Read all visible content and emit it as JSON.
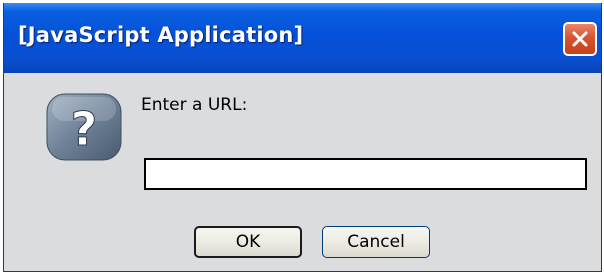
{
  "window": {
    "title": "[JavaScript Application]"
  },
  "dialog": {
    "icon": "question-icon",
    "prompt": "Enter a URL:",
    "input": {
      "value": "",
      "placeholder": ""
    },
    "ok_label": "OK",
    "cancel_label": "Cancel"
  },
  "colors": {
    "titlebar": "#0551d9",
    "close_button": "#d75432",
    "dialog_background": "#dadcdd"
  }
}
